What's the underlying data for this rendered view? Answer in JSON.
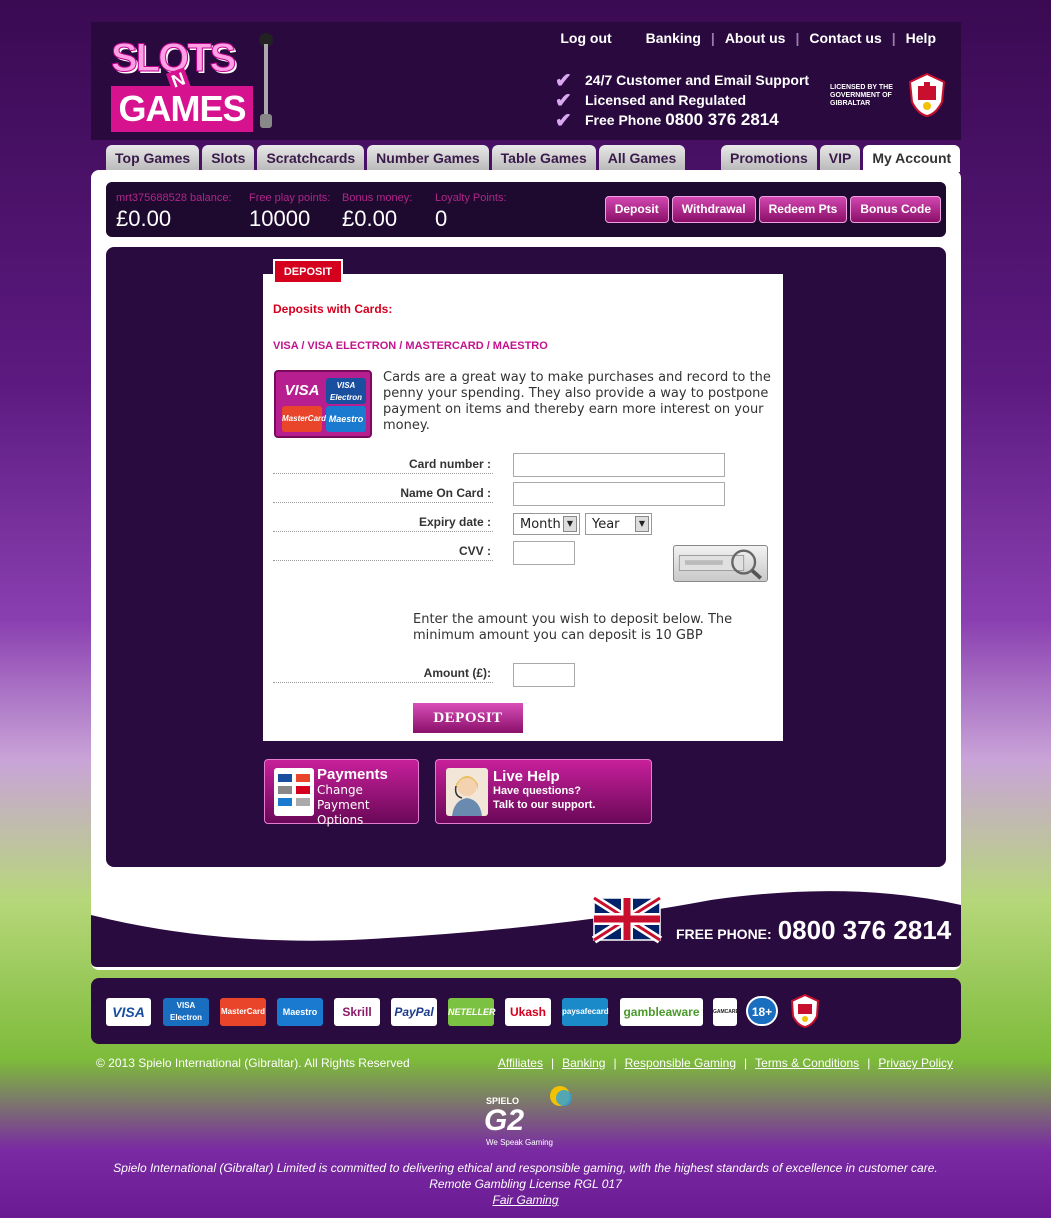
{
  "brand": {
    "logo_top": "SLOTS",
    "logo_mid": "N",
    "logo_bottom": "GAMES"
  },
  "toplinks": [
    "Log out",
    "Banking",
    "About us",
    "Contact us",
    "Help"
  ],
  "features": {
    "support": "24/7 Customer and Email Support",
    "licensed": "Licensed and Regulated",
    "phone_label": "Free Phone",
    "phone_number": "0800 376 2814"
  },
  "license_text": "LICENSED BY THE GOVERNMENT OF GIBRALTAR",
  "tabs_left": [
    "Top Games",
    "Slots",
    "Scratchcards",
    "Number Games",
    "Table Games",
    "All Games"
  ],
  "tabs_right": [
    "Promotions",
    "VIP",
    "My Account"
  ],
  "balances": [
    {
      "label": "mrt375688528 balance:",
      "value": "£0.00"
    },
    {
      "label": "Free play points:",
      "value": "10000"
    },
    {
      "label": "Bonus money:",
      "value": "£0.00"
    },
    {
      "label": "Loyalty Points:",
      "value": "0"
    }
  ],
  "account_buttons": [
    "Deposit",
    "Withdrawal",
    "Redeem Pts",
    "Bonus Code"
  ],
  "deposit": {
    "tab": "DEPOSIT",
    "title": "Deposits with Cards:",
    "card_types": "VISA / VISA ELECTRON / MASTERCARD / MAESTRO",
    "card_logos": {
      "visa": "VISA",
      "electron": "VISA Electron",
      "mastercard": "MasterCard",
      "maestro": "Maestro"
    },
    "description": "Cards are a great way to make purchases and record to the penny your spending. They also provide a way to postpone payment on items and thereby earn more interest on your money.",
    "fields": {
      "card_number": "Card number :",
      "name_on_card": "Name On Card :",
      "expiry": "Expiry date :",
      "cvv": "CVV :",
      "amount": "Amount (£):"
    },
    "expiry_month": "Month",
    "expiry_year": "Year",
    "amount_note": "Enter the amount you wish to deposit below. The minimum amount you can deposit is 10 GBP",
    "submit": "DEPOSIT"
  },
  "promos": {
    "payments_title": "Payments",
    "payments_sub": "Change Payment Options",
    "help_title": "Live Help",
    "help_sub1": "Have questions?",
    "help_sub2": "Talk to our support."
  },
  "footer": {
    "phone_label": "FREE PHONE:",
    "phone_number": "0800 376 2814",
    "pay_logos": [
      "VISA",
      "VISA Electron",
      "MasterCard",
      "Maestro",
      "Skrill",
      "PayPal",
      "NETELLER",
      "Ukash",
      "paysafecard",
      "gambleaware",
      "GAMCARE",
      "18+"
    ],
    "copyright": "© 2013 Spielo International (Gibraltar). All Rights Reserved",
    "links": [
      "Affiliates",
      "Banking",
      "Responsible Gaming",
      "Terms & Conditions",
      "Privacy Policy"
    ],
    "g2_brand": "SPIELO",
    "g2_logo": "G2",
    "g2_tagline": "We Speak Gaming",
    "disclaimer1": "Spielo International (Gibraltar) Limited is committed to delivering ethical and responsible gaming, with the highest standards of excellence in customer care.",
    "disclaimer2": "Remote Gambling License RGL 017",
    "fair": "Fair Gaming"
  }
}
